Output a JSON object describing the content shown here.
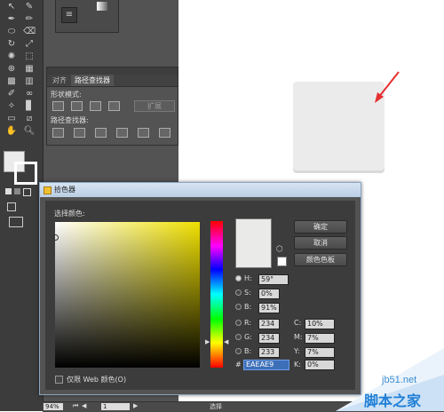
{
  "pathfinder": {
    "tab_align": "对齐",
    "tab_pathfinder": "路径查找器",
    "shape_modes_label": "形状模式:",
    "pathfinders_label": "路径查找器:",
    "expand_button": "扩展"
  },
  "color_picker": {
    "title": "拾色器",
    "select_color_label": "选择颜色:",
    "ok_button": "确定",
    "cancel_button": "取消",
    "swatches_button": "颜色色板",
    "fields": {
      "H": {
        "label": "H:",
        "value": "59°"
      },
      "S": {
        "label": "S:",
        "value": "0%"
      },
      "B": {
        "label": "B:",
        "value": "91%"
      },
      "R": {
        "label": "R:",
        "value": "234"
      },
      "G": {
        "label": "G:",
        "value": "234"
      },
      "Bl": {
        "label": "B:",
        "value": "233"
      },
      "C": {
        "label": "C:",
        "value": "10%"
      },
      "M": {
        "label": "M:",
        "value": "7%"
      },
      "Y": {
        "label": "Y:",
        "value": "7%"
      },
      "K": {
        "label": "K:",
        "value": "0%"
      },
      "hex_label": "#",
      "hex_value": "EAEAE9"
    },
    "web_only_label": "仅限 Web 颜色(O)",
    "current_color": "#eaeae9"
  },
  "status_bar": {
    "zoom": "94%",
    "page": "1",
    "tool": "选择"
  },
  "watermark": {
    "url": "jb51.net",
    "text": "脚本之家"
  },
  "colors": {
    "arrow": "#e53030",
    "selected_square": "#ebebeb"
  }
}
